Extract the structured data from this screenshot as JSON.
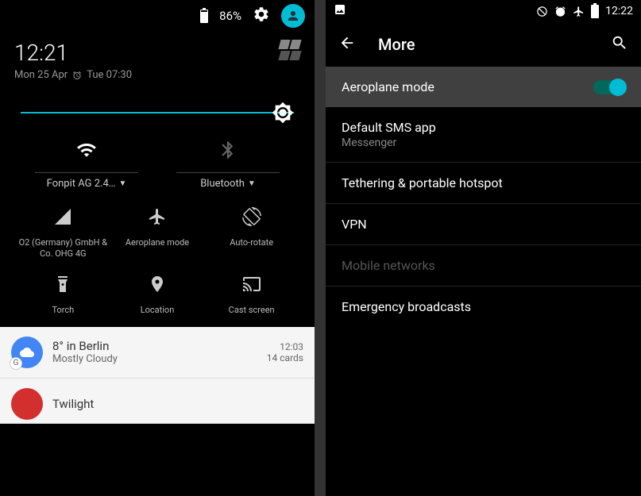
{
  "left": {
    "status": {
      "battery": "86%"
    },
    "clock": "12:21",
    "date": "Mon 25 Apr",
    "alarm": "Tue 07:30",
    "wifi": {
      "label": "Fonpit AG 2.4…"
    },
    "bt": {
      "label": "Bluetooth"
    },
    "tiles": {
      "signal": "O2 (Germany) GmbH & Co. OHG 4G",
      "airplane": "Aeroplane mode",
      "rotate": "Auto-rotate",
      "torch": "Torch",
      "location": "Location",
      "cast": "Cast screen"
    },
    "notif1": {
      "title": "8° in Berlin",
      "sub": "Mostly Cloudy",
      "time": "12:03",
      "count": "14 cards"
    },
    "notif2": {
      "title": "Twilight"
    }
  },
  "right": {
    "status": {
      "time": "12:22"
    },
    "title": "More",
    "rows": {
      "airplane": "Aeroplane mode",
      "sms_title": "Default SMS app",
      "sms_sub": "Messenger",
      "tether": "Tethering & portable hotspot",
      "vpn": "VPN",
      "mobile": "Mobile networks",
      "emergency": "Emergency broadcasts"
    }
  }
}
